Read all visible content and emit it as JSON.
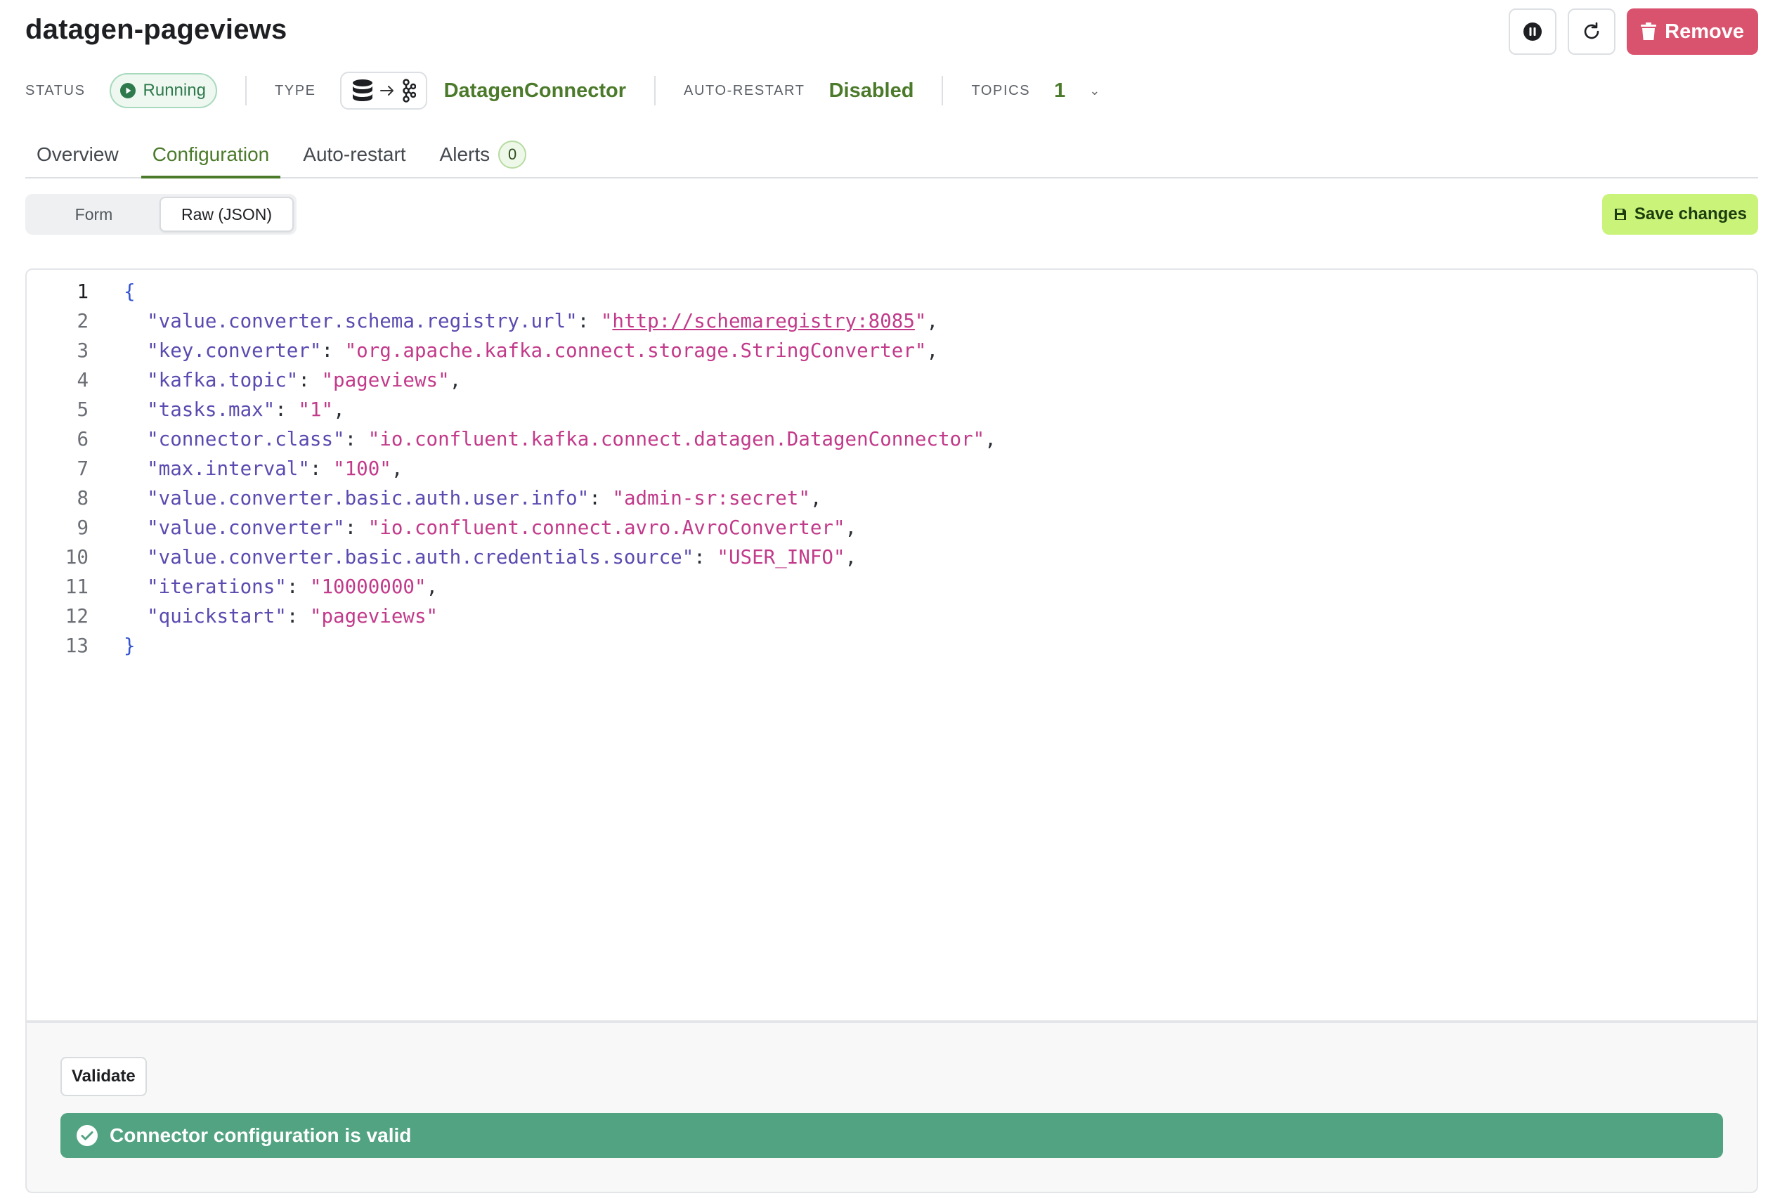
{
  "header": {
    "title": "datagen-pageviews",
    "remove_label": "Remove"
  },
  "meta": {
    "status_label": "STATUS",
    "status_value": "Running",
    "type_label": "TYPE",
    "type_value": "DatagenConnector",
    "autorestart_label": "AUTO-RESTART",
    "autorestart_value": "Disabled",
    "topics_label": "TOPICS",
    "topics_value": "1"
  },
  "tabs": [
    {
      "label": "Overview"
    },
    {
      "label": "Configuration"
    },
    {
      "label": "Auto-restart"
    },
    {
      "label": "Alerts",
      "badge": "0"
    }
  ],
  "view_switch": {
    "form_label": "Form",
    "raw_label": "Raw (JSON)",
    "selected": "Raw (JSON)"
  },
  "save_label": "Save changes",
  "editor": {
    "lines": [
      {
        "n": "1",
        "type": "open",
        "text": "{"
      },
      {
        "n": "2",
        "key": "value.converter.schema.registry.url",
        "value": "http://schemaregistry:8085",
        "comma": ","
      },
      {
        "n": "3",
        "key": "key.converter",
        "value": "org.apache.kafka.connect.storage.StringConverter",
        "comma": ","
      },
      {
        "n": "4",
        "key": "kafka.topic",
        "value": "pageviews",
        "comma": ","
      },
      {
        "n": "5",
        "key": "tasks.max",
        "value": "1",
        "comma": ","
      },
      {
        "n": "6",
        "key": "connector.class",
        "value": "io.confluent.kafka.connect.datagen.DatagenConnector",
        "comma": ","
      },
      {
        "n": "7",
        "key": "max.interval",
        "value": "100",
        "comma": ","
      },
      {
        "n": "8",
        "key": "value.converter.basic.auth.user.info",
        "value": "admin-sr:secret",
        "comma": ","
      },
      {
        "n": "9",
        "key": "value.converter",
        "value": "io.confluent.connect.avro.AvroConverter",
        "comma": ","
      },
      {
        "n": "10",
        "key": "value.converter.basic.auth.credentials.source",
        "value": "USER_INFO",
        "comma": ","
      },
      {
        "n": "11",
        "key": "iterations",
        "value": "10000000",
        "comma": ","
      },
      {
        "n": "12",
        "key": "quickstart",
        "value": "pageviews",
        "comma": ""
      },
      {
        "n": "13",
        "type": "close",
        "text": "}"
      }
    ]
  },
  "validate_label": "Validate",
  "validation_message": "Connector configuration is valid",
  "colors": {
    "accent": "#4b7a2a",
    "remove": "#d9536e",
    "save": "#c9f479",
    "valid": "#52a382"
  }
}
